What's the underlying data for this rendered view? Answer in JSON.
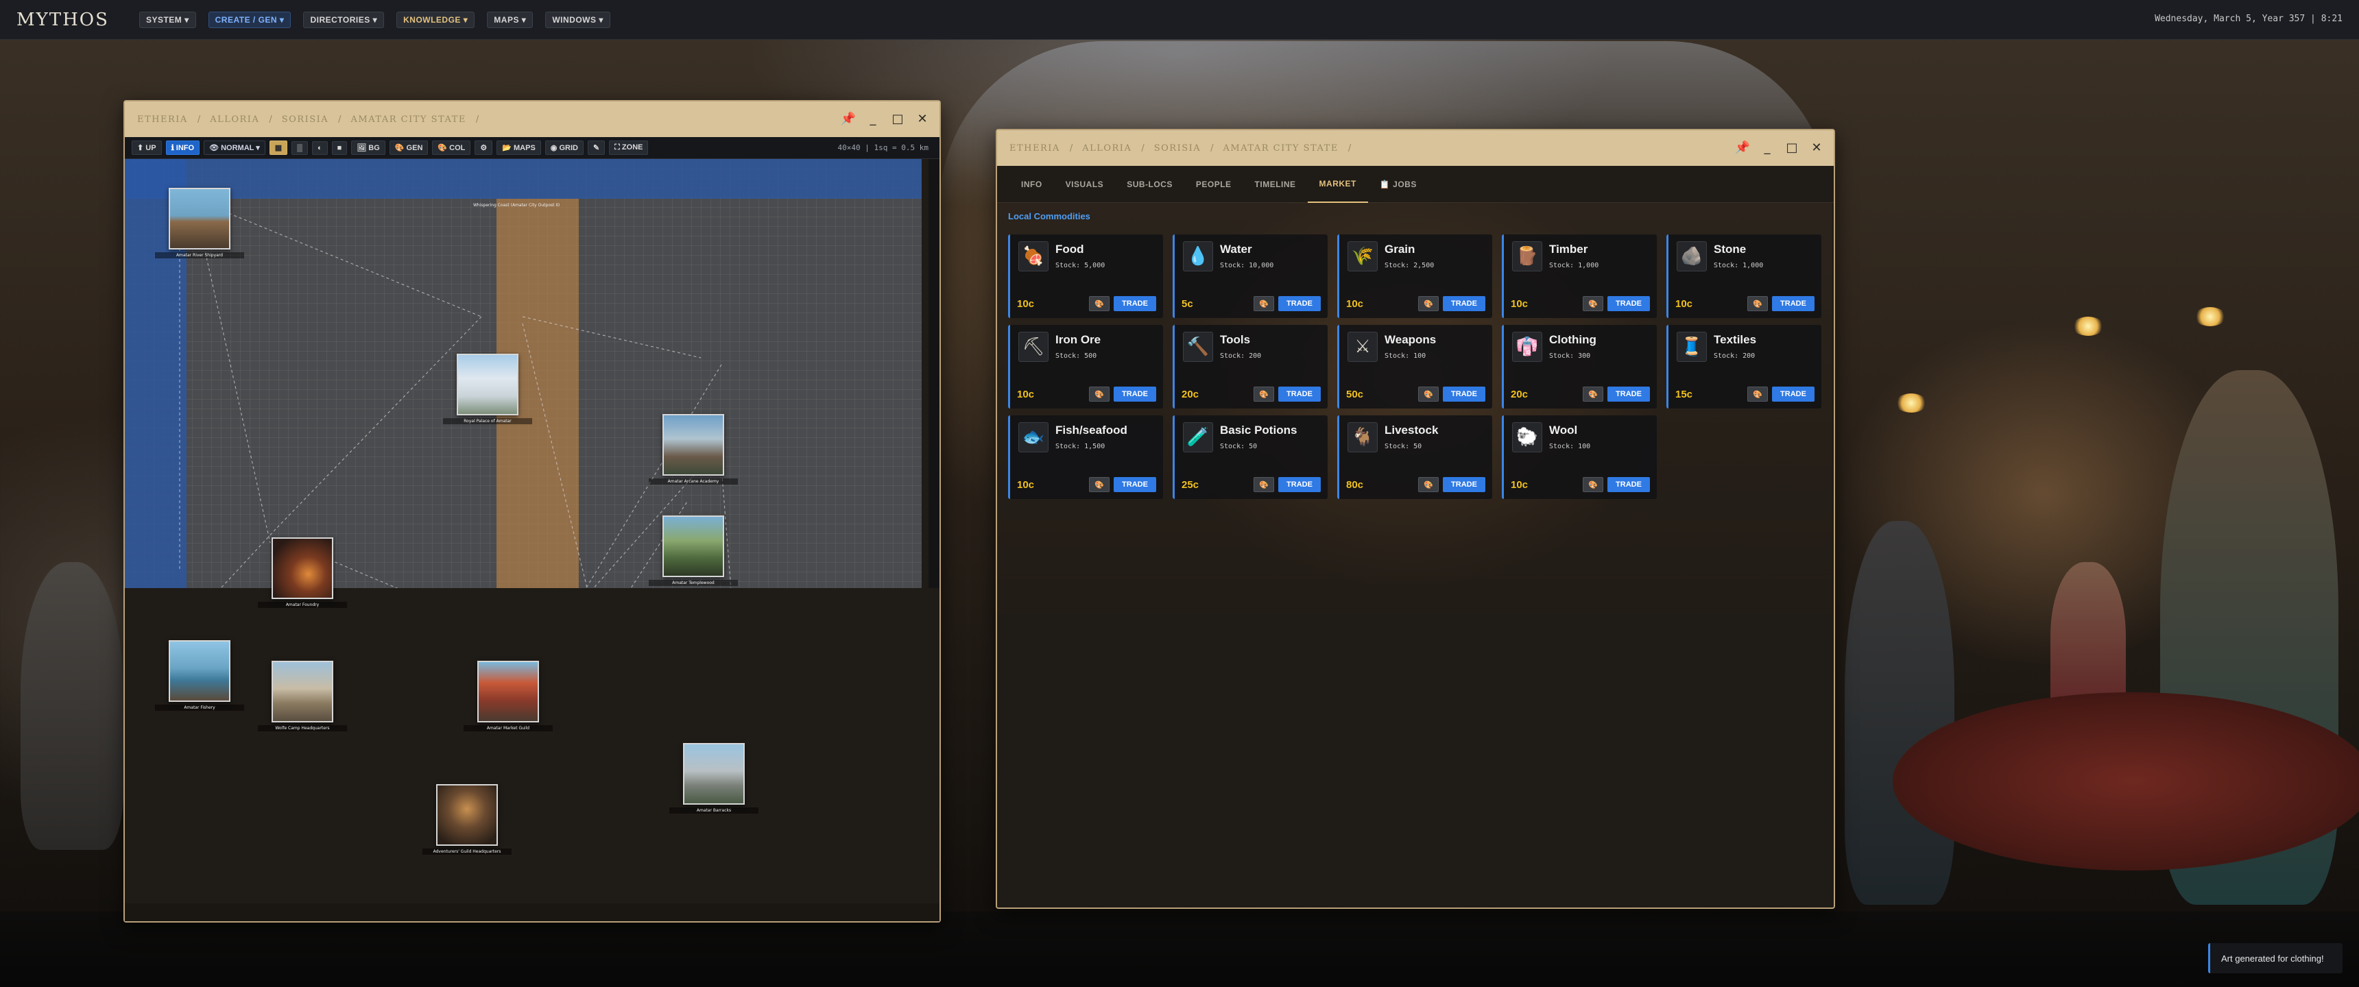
{
  "topbar": {
    "logo": "MYTHOS",
    "menus": [
      "SYSTEM ▾",
      "CREATE / GEN ▾",
      "DIRECTORIES ▾",
      "KNOWLEDGE ▾",
      "MAPS ▾",
      "WINDOWS ▾"
    ],
    "clock": "Wednesday, March 5, Year 357 | 8:21"
  },
  "map_window": {
    "breadcrumb": [
      "ETHERIA",
      "ALLORIA",
      "SORISIA",
      "AMATAR CITY STATE"
    ],
    "toolbar": {
      "up": "⬆ UP",
      "info": "ℹ INFO",
      "mode": "👁 NORMAL ▾",
      "bg": "🖼 BG",
      "gen": "🎨 GEN",
      "col": "🎨 COL",
      "settings": "⚙",
      "maps": "📂 MAPS",
      "grid": "◉ GRID",
      "zone": "⛶ ZONE",
      "scale": "40×40 | 1sq = 0.5 km"
    },
    "zone_label": "Whispering Coast (Amatar City Outpost II)",
    "locations": [
      {
        "label": "Amatar River Shipyard"
      },
      {
        "label": "Royal Palace of Amatar"
      },
      {
        "label": "Amatar Arcane Academy"
      },
      {
        "label": "Amatar Templewood"
      },
      {
        "label": "Amatar Foundry"
      },
      {
        "label": "Amatar Fishery"
      },
      {
        "label": "Wolfe Camp Headquarters"
      },
      {
        "label": "Amatar Market Guild"
      },
      {
        "label": "Adventurers' Guild Headquarters"
      },
      {
        "label": "Amatar Barracks"
      }
    ]
  },
  "city_window": {
    "breadcrumb": [
      "ETHERIA",
      "ALLORIA",
      "SORISIA",
      "AMATAR CITY STATE"
    ],
    "tabs": [
      "INFO",
      "VISUALS",
      "SUB-LOCS",
      "PEOPLE",
      "TIMELINE",
      "MARKET",
      "📋 JOBS"
    ],
    "active_tab": "MARKET",
    "section_title": "Local Commodities",
    "trade_label": "TRADE",
    "commodities": [
      {
        "name": "Food",
        "stock": "Stock: 5,000",
        "price": "10c",
        "icon": "🍖"
      },
      {
        "name": "Water",
        "stock": "Stock: 10,000",
        "price": "5c",
        "icon": "💧"
      },
      {
        "name": "Grain",
        "stock": "Stock: 2,500",
        "price": "10c",
        "icon": "🌾"
      },
      {
        "name": "Timber",
        "stock": "Stock: 1,000",
        "price": "10c",
        "icon": "🪵"
      },
      {
        "name": "Stone",
        "stock": "Stock: 1,000",
        "price": "10c",
        "icon": "🪨"
      },
      {
        "name": "Iron Ore",
        "stock": "Stock: 500",
        "price": "10c",
        "icon": "⛏"
      },
      {
        "name": "Tools",
        "stock": "Stock: 200",
        "price": "20c",
        "icon": "🔨"
      },
      {
        "name": "Weapons",
        "stock": "Stock: 100",
        "price": "50c",
        "icon": "⚔"
      },
      {
        "name": "Clothing",
        "stock": "Stock: 300",
        "price": "20c",
        "icon": "👘"
      },
      {
        "name": "Textiles",
        "stock": "Stock: 200",
        "price": "15c",
        "icon": "🧵"
      },
      {
        "name": "Fish/seafood",
        "stock": "Stock: 1,500",
        "price": "10c",
        "icon": "🐟"
      },
      {
        "name": "Basic Potions",
        "stock": "Stock: 50",
        "price": "25c",
        "icon": "🧪"
      },
      {
        "name": "Livestock",
        "stock": "Stock: 50",
        "price": "80c",
        "icon": "🐐"
      },
      {
        "name": "Wool",
        "stock": "Stock: 100",
        "price": "10c",
        "icon": "🐑"
      }
    ]
  },
  "toast": {
    "message": "Art generated for clothing!"
  },
  "colors": {
    "accent": "#2f7ae5",
    "price": "#f2c21e",
    "title_bar": "#d8c39a",
    "frame": "#b9a179"
  }
}
